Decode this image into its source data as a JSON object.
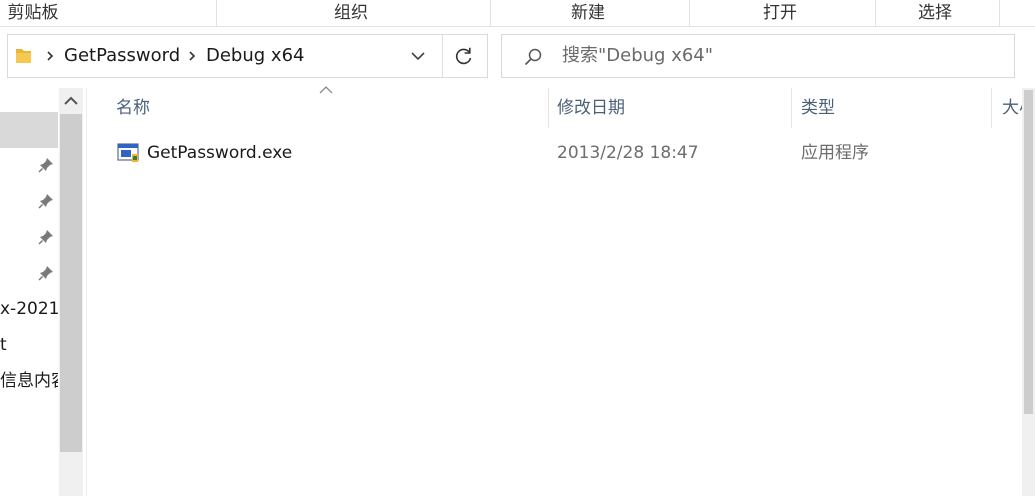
{
  "ribbon": {
    "groups": [
      "剪贴板",
      "组织",
      "新建",
      "打开",
      "选择"
    ]
  },
  "address_bar": {
    "breadcrumbs": [
      "GetPassword",
      "Debug x64"
    ]
  },
  "search": {
    "placeholder": "搜索\"Debug x64\""
  },
  "nav_pane": {
    "items": [
      "x-2021",
      "t",
      "信息内容"
    ],
    "pinned_count": 4
  },
  "file_list": {
    "columns": [
      "名称",
      "修改日期",
      "类型",
      "大小"
    ],
    "rows": [
      {
        "name": "GetPassword.exe",
        "modified": "2013/2/28 18:47",
        "type": "应用程序"
      }
    ]
  },
  "colors": {
    "accent_folder": "#e8b63a",
    "column_header_text": "#4c607a",
    "secondary_text": "#6d6d6d",
    "selection": "#d9d9d9"
  }
}
